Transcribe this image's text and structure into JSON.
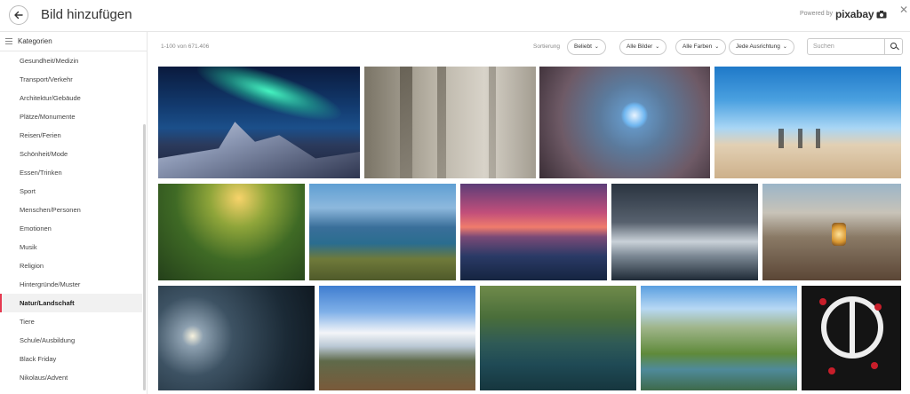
{
  "header": {
    "title": "Bild hinzufügen",
    "powered_by": "Powered by",
    "brand": "pixabay"
  },
  "sidebar": {
    "heading": "Kategorien",
    "items": [
      {
        "label": "Gesundheit/Medizin"
      },
      {
        "label": "Transport/Verkehr"
      },
      {
        "label": "Architektur/Gebäude"
      },
      {
        "label": "Plätze/Monumente"
      },
      {
        "label": "Reisen/Ferien"
      },
      {
        "label": "Schönheit/Mode"
      },
      {
        "label": "Essen/Trinken"
      },
      {
        "label": "Sport"
      },
      {
        "label": "Menschen/Personen"
      },
      {
        "label": "Emotionen"
      },
      {
        "label": "Musik"
      },
      {
        "label": "Religion"
      },
      {
        "label": "Hintergründe/Muster"
      },
      {
        "label": "Natur/Landschaft",
        "active": true
      },
      {
        "label": "Tiere"
      },
      {
        "label": "Schule/Ausbildung"
      },
      {
        "label": "Black Friday"
      },
      {
        "label": "Nikolaus/Advent"
      }
    ]
  },
  "toolbar": {
    "result_count": "1-100 von 671.406",
    "sort_label": "Sortierung",
    "filters": [
      {
        "label": "Beliebt"
      },
      {
        "label": "Alle Bilder"
      },
      {
        "label": "Alle Farben"
      },
      {
        "label": "Jede Ausrichtung"
      }
    ],
    "search_placeholder": "Suchen"
  },
  "accent_color": "#e53950",
  "gallery": {
    "rows": [
      [
        "aurora-mountains",
        "foggy-forest",
        "dandelion-macro",
        "desert-runners"
      ],
      [
        "sunlit-forest",
        "mountain-lake",
        "pink-sunset-sea",
        "crashing-wave",
        "lantern-shore"
      ],
      [
        "water-sparkle",
        "snowy-alps",
        "green-pond",
        "green-valley-lake",
        "peace-roses"
      ]
    ]
  }
}
